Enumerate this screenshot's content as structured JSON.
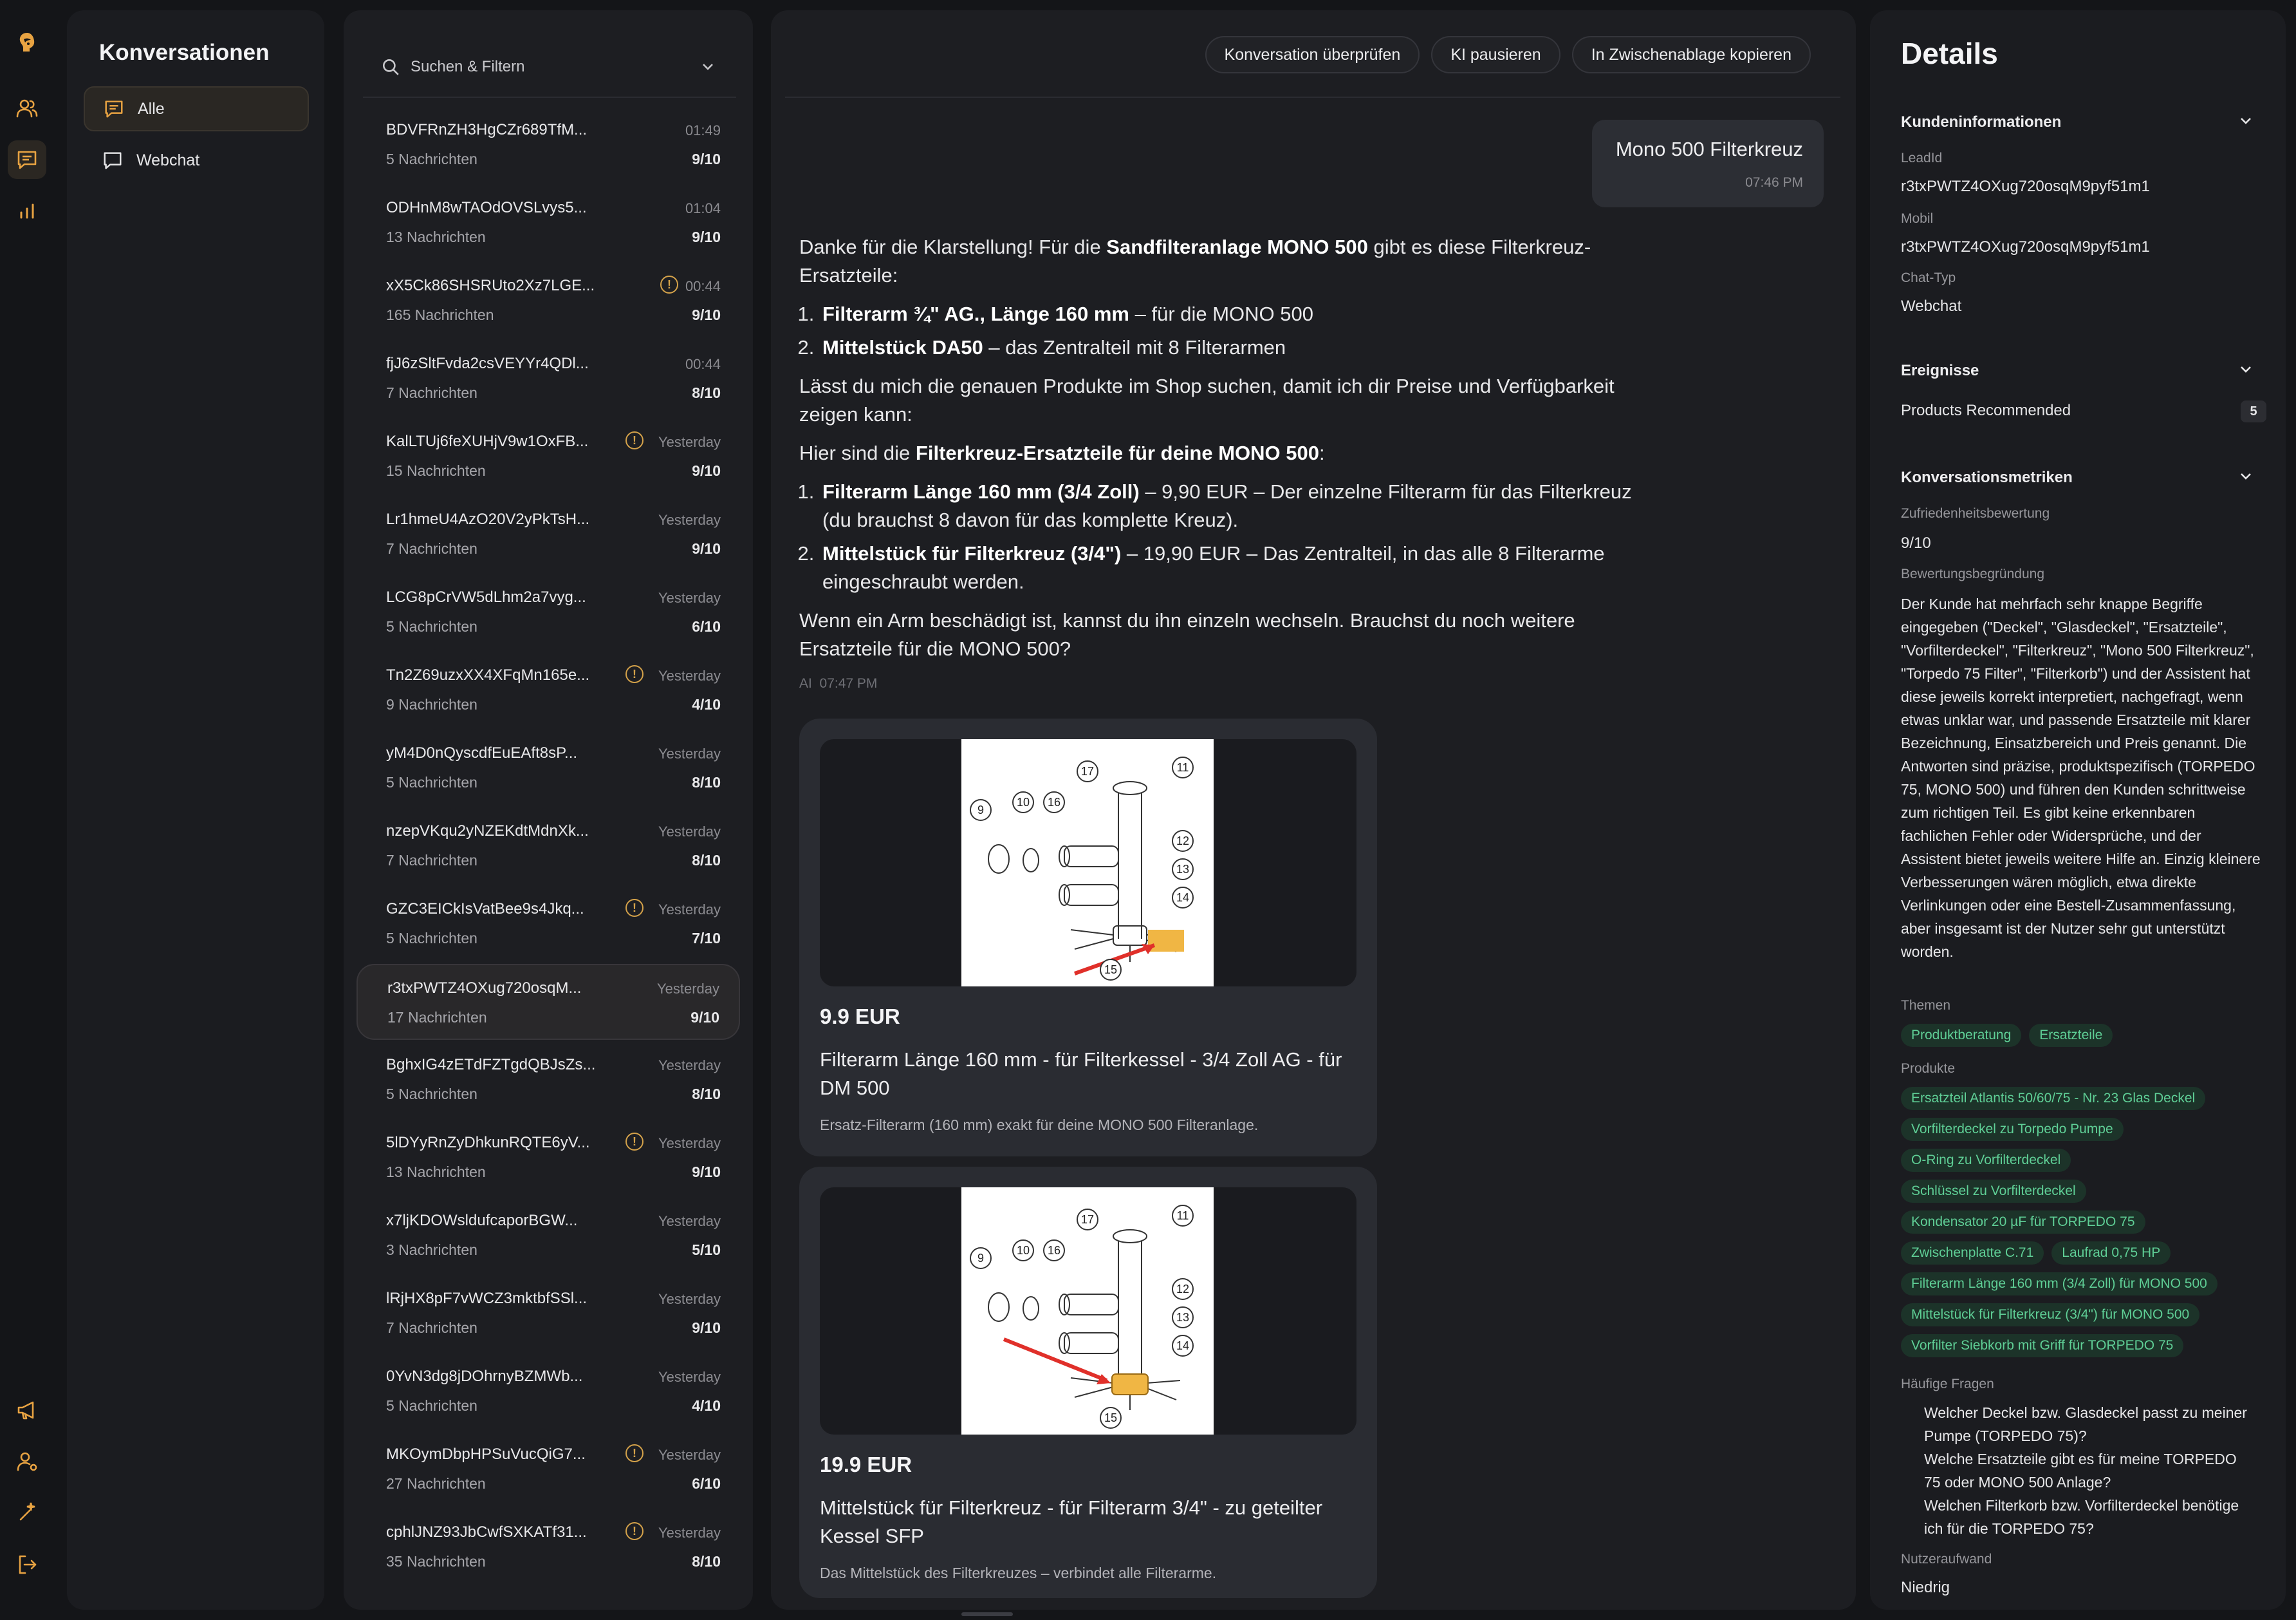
{
  "colors": {
    "accent": "#e8a342",
    "chip_bg": "#1c3329",
    "chip_text": "#5fcf96",
    "warn": "#d4a24a"
  },
  "rail": {
    "top_icons": [
      "logo-icon",
      "users-icon",
      "chat-icon",
      "bar-chart-icon"
    ],
    "bottom_icons": [
      "megaphone-icon",
      "user-settings-icon",
      "magic-wand-icon",
      "logout-icon"
    ]
  },
  "nav": {
    "title": "Konversationen",
    "items": [
      {
        "label": "Alle",
        "icon": "chat-icon",
        "active": true
      },
      {
        "label": "Webchat",
        "icon": "message-icon",
        "active": false
      }
    ]
  },
  "list": {
    "search_placeholder": "Suchen & Filtern",
    "conversations": [
      {
        "id": "BDVFRnZH3HgCZr689TfM...",
        "count": "5 Nachrichten",
        "time": "01:49",
        "score": "9/10",
        "warn": false
      },
      {
        "id": "ODHnM8wTAOdOVSLvys5...",
        "count": "13 Nachrichten",
        "time": "01:04",
        "score": "9/10",
        "warn": false
      },
      {
        "id": "xX5Ck86SHSRUto2Xz7LGE...",
        "count": "165 Nachrichten",
        "time": "00:44",
        "score": "9/10",
        "warn": true
      },
      {
        "id": "fjJ6zSltFvda2csVEYYr4QDl...",
        "count": "7 Nachrichten",
        "time": "00:44",
        "score": "8/10",
        "warn": false
      },
      {
        "id": "KalLTUj6feXUHjV9w1OxFB...",
        "count": "15 Nachrichten",
        "time": "Yesterday",
        "score": "9/10",
        "warn": true
      },
      {
        "id": "Lr1hmeU4AzO20V2yPkTsH...",
        "count": "7 Nachrichten",
        "time": "Yesterday",
        "score": "9/10",
        "warn": false
      },
      {
        "id": "LCG8pCrVW5dLhm2a7vyg...",
        "count": "5 Nachrichten",
        "time": "Yesterday",
        "score": "6/10",
        "warn": false
      },
      {
        "id": "Tn2Z69uzxXX4XFqMn165e...",
        "count": "9 Nachrichten",
        "time": "Yesterday",
        "score": "4/10",
        "warn": true
      },
      {
        "id": "yM4D0nQyscdfEuEAft8sP...",
        "count": "5 Nachrichten",
        "time": "Yesterday",
        "score": "8/10",
        "warn": false
      },
      {
        "id": "nzepVKqu2yNZEKdtMdnXk...",
        "count": "7 Nachrichten",
        "time": "Yesterday",
        "score": "8/10",
        "warn": false
      },
      {
        "id": "GZC3EICkIsVatBee9s4Jkq...",
        "count": "5 Nachrichten",
        "time": "Yesterday",
        "score": "7/10",
        "warn": true
      },
      {
        "id": "r3txPWTZ4OXug720osqM...",
        "count": "17 Nachrichten",
        "time": "Yesterday",
        "score": "9/10",
        "warn": false,
        "active": true
      },
      {
        "id": "BghxIG4zETdFZTgdQBJsZs...",
        "count": "5 Nachrichten",
        "time": "Yesterday",
        "score": "8/10",
        "warn": false
      },
      {
        "id": "5lDYyRnZyDhkunRQTE6yV...",
        "count": "13 Nachrichten",
        "time": "Yesterday",
        "score": "9/10",
        "warn": true
      },
      {
        "id": "x7ljKDOWsldufcaporBGW...",
        "count": "3 Nachrichten",
        "time": "Yesterday",
        "score": "5/10",
        "warn": false
      },
      {
        "id": "lRjHX8pF7vWCZ3mktbfSSl...",
        "count": "7 Nachrichten",
        "time": "Yesterday",
        "score": "9/10",
        "warn": false
      },
      {
        "id": "0YvN3dg8jDOhrnyBZMWb...",
        "count": "5 Nachrichten",
        "time": "Yesterday",
        "score": "4/10",
        "warn": false
      },
      {
        "id": "MKOymDbpHPSuVucQiG7...",
        "count": "27 Nachrichten",
        "time": "Yesterday",
        "score": "6/10",
        "warn": true
      },
      {
        "id": "cphlJNZ93JbCwfSXKATf31...",
        "count": "35 Nachrichten",
        "time": "Yesterday",
        "score": "8/10",
        "warn": true
      }
    ]
  },
  "chat": {
    "actions": [
      "Konversation überprüfen",
      "KI pausieren",
      "In Zwischenablage kopieren"
    ],
    "user_message": {
      "text": "Mono 500 Filterkreuz",
      "time": "07:46 PM"
    },
    "ai_message": {
      "p1_pre": "Danke für die Klarstellung! Für die ",
      "p1_bold": "Sandfilteranlage MONO 500",
      "p1_post": " gibt es diese Filterkreuz-Ersatzteile:",
      "list1": [
        {
          "bold": "Filterarm ¾\" AG., Länge 160 mm",
          "rest": " – für die MONO 500"
        },
        {
          "bold": "Mittelstück DA50",
          "rest": " – das Zentralteil mit 8 Filterarmen"
        }
      ],
      "p2": "Lässt du mich die genauen Produkte im Shop suchen, damit ich dir Preise und Verfügbarkeit zeigen kann:",
      "p3_pre": "Hier sind die ",
      "p3_bold": "Filterkreuz-Ersatzteile für deine MONO 500",
      "p3_post": ":",
      "list2": [
        {
          "bold": "Filterarm Länge 160 mm (3/4 Zoll)",
          "rest": " – 9,90 EUR – Der einzelne Filterarm für das Filterkreuz (du brauchst 8 davon für das komplette Kreuz)."
        },
        {
          "bold": "Mittelstück für Filterkreuz (3/4\")",
          "rest": " – 19,90 EUR – Das Zentralteil, in das alle 8 Filterarme eingeschraubt werden."
        }
      ],
      "p4": "Wenn ein Arm beschädigt ist, kannst du ihn einzeln wechseln. Brauchst du noch weitere Ersatzteile für die MONO 500?",
      "sender": "AI",
      "time": "07:47 PM"
    },
    "products": [
      {
        "price": "9.9 EUR",
        "title": "Filterarm Länge 160 mm - für Filterkessel - 3/4 Zoll AG - für DM 500",
        "desc": "Ersatz-Filterarm (160 mm) exakt für deine MONO 500 Filteranlage."
      },
      {
        "price": "19.9 EUR",
        "title": "Mittelstück für Filterkreuz - für Filterarm 3/4\" - zu geteilter Kessel SFP",
        "desc": "Das Mittelstück des Filterkreuzes – verbindet alle Filterarme."
      }
    ],
    "diagram_labels": [
      "17",
      "11",
      "9",
      "10",
      "16",
      "12",
      "13",
      "14",
      "15"
    ]
  },
  "details": {
    "title": "Details",
    "customer": {
      "heading": "Kundeninformationen",
      "leadid_label": "LeadId",
      "leadid": "r3txPWTZ4OXug720osqM9pyf51m1",
      "mobile_label": "Mobil",
      "mobile": "r3txPWTZ4OXug720osqM9pyf51m1",
      "chattype_label": "Chat-Typ",
      "chattype": "Webchat"
    },
    "events": {
      "heading": "Ereignisse",
      "item": "Products Recommended",
      "count": "5"
    },
    "metrics": {
      "heading": "Konversationsmetriken",
      "satisfaction_label": "Zufriedenheitsbewertung",
      "satisfaction": "9/10",
      "reason_label": "Bewertungsbegründung",
      "reason": "Der Kunde hat mehrfach sehr knappe Begriffe eingegeben (\"Deckel\", \"Glasdeckel\", \"Ersatzteile\", \"Vorfilterdeckel\", \"Filterkreuz\", \"Mono 500 Filterkreuz\", \"Torpedo 75 Filter\", \"Filterkorb\") und der Assistent hat diese jeweils korrekt interpretiert, nachgefragt, wenn etwas unklar war, und passende Ersatzteile mit klarer Bezeichnung, Einsatzbereich und Preis genannt. Die Antworten sind präzise, produktspezifisch (TORPEDO 75, MONO 500) und führen den Kunden schrittweise zum richtigen Teil. Es gibt keine erkennbaren fachlichen Fehler oder Widersprüche, und der Assistent bietet jeweils weitere Hilfe an. Einzig kleinere Verbesserungen wären möglich, etwa direkte Verlinkungen oder eine Bestell-Zusammenfassung, aber insgesamt ist der Nutzer sehr gut unterstützt worden.",
      "topics_label": "Themen",
      "topics": [
        "Produktberatung",
        "Ersatzteile"
      ],
      "products_label": "Produkte",
      "products": [
        "Ersatzteil Atlantis 50/60/75 - Nr. 23 Glas Deckel",
        "Vorfilterdeckel zu Torpedo Pumpe",
        "O-Ring zu Vorfilterdeckel",
        "Schlüssel zu Vorfilterdeckel",
        "Kondensator 20 µF für TORPEDO 75",
        "Zwischenplatte C.71",
        "Laufrad 0,75 HP",
        "Filterarm Länge 160 mm (3/4 Zoll) für MONO 500",
        "Mittelstück für Filterkreuz (3/4\") für MONO 500",
        "Vorfilter Siebkorb mit Griff für TORPEDO 75"
      ],
      "faq_label": "Häufige Fragen",
      "faq": [
        "Welcher Deckel bzw. Glasdeckel passt zu meiner Pumpe (TORPEDO 75)?",
        "Welche Ersatzteile gibt es für meine TORPEDO 75 oder MONO 500 Anlage?",
        "Welchen Filterkorb bzw. Vorfilterdeckel benötige ich für die TORPEDO 75?"
      ],
      "effort_label": "Nutzeraufwand",
      "effort": "Niedrig"
    }
  }
}
